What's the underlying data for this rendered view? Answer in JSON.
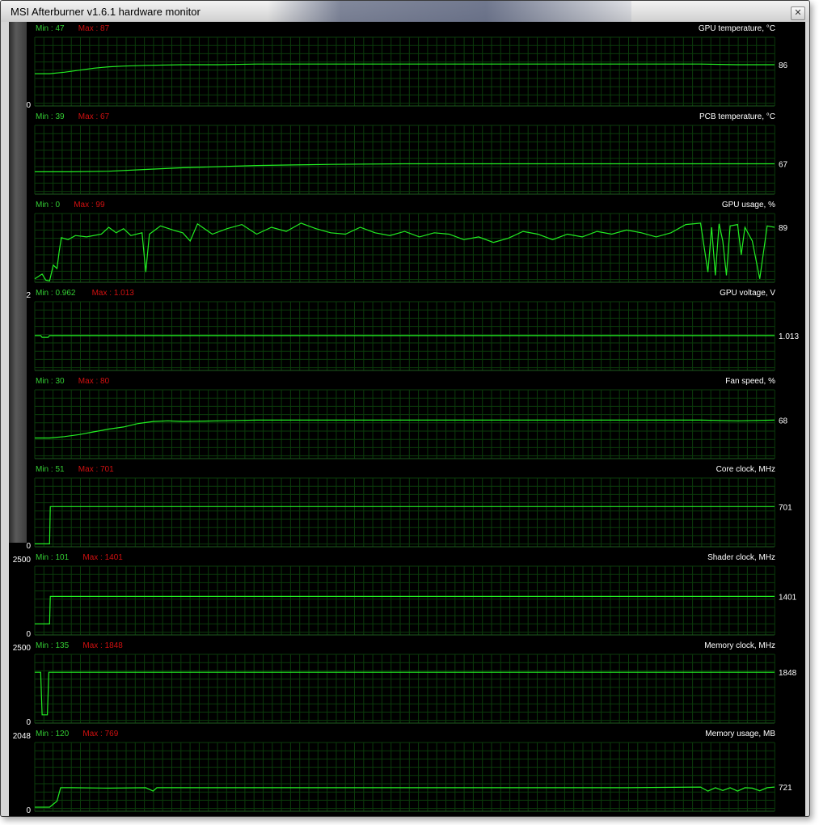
{
  "window": {
    "title": "MSI Afterburner v1.6.1 hardware monitor",
    "close_glyph": "✕"
  },
  "colors": {
    "background": "#000000",
    "grid": "#0b3b0b",
    "line": "#22ee22",
    "min_text": "#33cc33",
    "max_text": "#d01010",
    "label_text": "#ffffff"
  },
  "graphs": [
    {
      "label": "GPU temperature, °C",
      "min": "Min : 47",
      "max": "Max : 87",
      "current": "86",
      "axis_top": "",
      "axis_bottom": "0",
      "range": [
        0,
        100
      ],
      "points": [
        [
          0,
          47
        ],
        [
          0.02,
          47
        ],
        [
          0.04,
          49
        ],
        [
          0.06,
          52
        ],
        [
          0.08,
          55
        ],
        [
          0.1,
          57
        ],
        [
          0.12,
          58
        ],
        [
          0.15,
          59
        ],
        [
          0.2,
          60
        ],
        [
          0.25,
          60
        ],
        [
          0.3,
          61
        ],
        [
          0.4,
          61
        ],
        [
          0.5,
          61
        ],
        [
          0.6,
          61
        ],
        [
          0.7,
          61
        ],
        [
          0.8,
          61
        ],
        [
          0.9,
          61
        ],
        [
          0.95,
          60
        ],
        [
          1,
          60
        ]
      ]
    },
    {
      "label": "PCB temperature, °C",
      "min": "Min : 39",
      "max": "Max : 67",
      "current": "67",
      "axis_top": "",
      "axis_bottom": "",
      "range": [
        0,
        120
      ],
      "points": [
        [
          0,
          39
        ],
        [
          0.05,
          39
        ],
        [
          0.1,
          40
        ],
        [
          0.15,
          43
        ],
        [
          0.2,
          46
        ],
        [
          0.25,
          48
        ],
        [
          0.3,
          50
        ],
        [
          0.35,
          51
        ],
        [
          0.4,
          52
        ],
        [
          0.5,
          53
        ],
        [
          0.6,
          53
        ],
        [
          0.7,
          53
        ],
        [
          0.8,
          53
        ],
        [
          0.9,
          53
        ],
        [
          1,
          53
        ]
      ]
    },
    {
      "label": "GPU usage, %",
      "min": "Min : 0",
      "max": "Max : 99",
      "current": "89",
      "axis_top": "",
      "axis_bottom": "",
      "range": [
        0,
        100
      ],
      "points": [
        [
          0,
          5
        ],
        [
          0.01,
          12
        ],
        [
          0.015,
          3
        ],
        [
          0.02,
          2
        ],
        [
          0.025,
          25
        ],
        [
          0.03,
          20
        ],
        [
          0.033,
          45
        ],
        [
          0.036,
          65
        ],
        [
          0.045,
          62
        ],
        [
          0.055,
          68
        ],
        [
          0.07,
          66
        ],
        [
          0.09,
          70
        ],
        [
          0.1,
          80
        ],
        [
          0.11,
          72
        ],
        [
          0.12,
          78
        ],
        [
          0.13,
          68
        ],
        [
          0.145,
          72
        ],
        [
          0.15,
          15
        ],
        [
          0.155,
          70
        ],
        [
          0.17,
          82
        ],
        [
          0.19,
          75
        ],
        [
          0.2,
          72
        ],
        [
          0.21,
          60
        ],
        [
          0.22,
          85
        ],
        [
          0.24,
          70
        ],
        [
          0.26,
          78
        ],
        [
          0.28,
          84
        ],
        [
          0.3,
          70
        ],
        [
          0.32,
          80
        ],
        [
          0.34,
          74
        ],
        [
          0.36,
          86
        ],
        [
          0.38,
          78
        ],
        [
          0.4,
          72
        ],
        [
          0.42,
          70
        ],
        [
          0.44,
          80
        ],
        [
          0.46,
          72
        ],
        [
          0.48,
          68
        ],
        [
          0.5,
          74
        ],
        [
          0.52,
          66
        ],
        [
          0.54,
          72
        ],
        [
          0.56,
          70
        ],
        [
          0.58,
          62
        ],
        [
          0.6,
          66
        ],
        [
          0.62,
          58
        ],
        [
          0.64,
          64
        ],
        [
          0.66,
          74
        ],
        [
          0.68,
          70
        ],
        [
          0.7,
          62
        ],
        [
          0.72,
          70
        ],
        [
          0.74,
          66
        ],
        [
          0.76,
          74
        ],
        [
          0.78,
          70
        ],
        [
          0.8,
          76
        ],
        [
          0.82,
          72
        ],
        [
          0.84,
          66
        ],
        [
          0.86,
          72
        ],
        [
          0.88,
          84
        ],
        [
          0.9,
          86
        ],
        [
          0.91,
          15
        ],
        [
          0.915,
          80
        ],
        [
          0.92,
          10
        ],
        [
          0.925,
          85
        ],
        [
          0.93,
          60
        ],
        [
          0.935,
          10
        ],
        [
          0.94,
          82
        ],
        [
          0.95,
          84
        ],
        [
          0.955,
          40
        ],
        [
          0.96,
          80
        ],
        [
          0.97,
          60
        ],
        [
          0.98,
          5
        ],
        [
          0.99,
          82
        ],
        [
          1,
          80
        ]
      ]
    },
    {
      "label": "GPU voltage, V",
      "min": "Min : 0.962",
      "max": "Max : 1.013",
      "current": "1.013",
      "axis_top": "2",
      "axis_bottom": "",
      "range": [
        0,
        2
      ],
      "points": [
        [
          0,
          1.013
        ],
        [
          0.008,
          1.013
        ],
        [
          0.01,
          0.962
        ],
        [
          0.018,
          0.962
        ],
        [
          0.02,
          1.013
        ],
        [
          1,
          1.013
        ]
      ]
    },
    {
      "label": "Fan speed, %",
      "min": "Min : 30",
      "max": "Max : 80",
      "current": "68",
      "axis_top": "",
      "axis_bottom": "",
      "range": [
        0,
        100
      ],
      "points": [
        [
          0,
          30
        ],
        [
          0.02,
          30
        ],
        [
          0.04,
          32
        ],
        [
          0.06,
          35
        ],
        [
          0.08,
          39
        ],
        [
          0.1,
          43
        ],
        [
          0.12,
          46
        ],
        [
          0.14,
          51
        ],
        [
          0.16,
          54
        ],
        [
          0.18,
          55
        ],
        [
          0.2,
          54
        ],
        [
          0.25,
          55
        ],
        [
          0.3,
          56
        ],
        [
          0.4,
          56
        ],
        [
          0.5,
          56
        ],
        [
          0.6,
          56
        ],
        [
          0.7,
          56
        ],
        [
          0.8,
          56
        ],
        [
          0.9,
          56
        ],
        [
          0.95,
          55
        ],
        [
          1,
          56
        ]
      ]
    },
    {
      "label": "Core clock, MHz",
      "min": "Min : 51",
      "max": "Max : 701",
      "current": "701",
      "axis_top": "",
      "axis_bottom": "0",
      "range": [
        0,
        1200
      ],
      "points": [
        [
          0,
          51
        ],
        [
          0.02,
          51
        ],
        [
          0.021,
          701
        ],
        [
          1,
          701
        ]
      ]
    },
    {
      "label": "Shader clock, MHz",
      "min": "Min : 101",
      "max": "Max : 1401",
      "current": "1401",
      "axis_top": "2500",
      "axis_bottom": "0",
      "range": [
        0,
        2500
      ],
      "points": [
        [
          0,
          400
        ],
        [
          0.02,
          400
        ],
        [
          0.021,
          1401
        ],
        [
          1,
          1401
        ]
      ]
    },
    {
      "label": "Memory clock, MHz",
      "min": "Min : 135",
      "max": "Max : 1848",
      "current": "1848",
      "axis_top": "2500",
      "axis_bottom": "0",
      "range": [
        0,
        2500
      ],
      "points": [
        [
          0,
          1848
        ],
        [
          0.008,
          1848
        ],
        [
          0.01,
          300
        ],
        [
          0.017,
          300
        ],
        [
          0.019,
          1848
        ],
        [
          1,
          1848
        ]
      ]
    },
    {
      "label": "Memory usage, MB",
      "min": "Min : 120",
      "max": "Max : 769",
      "current": "721",
      "axis_top": "2048",
      "axis_bottom": "0",
      "range": [
        0,
        2048
      ],
      "points": [
        [
          0,
          120
        ],
        [
          0.02,
          120
        ],
        [
          0.03,
          300
        ],
        [
          0.035,
          700
        ],
        [
          0.05,
          700
        ],
        [
          0.1,
          690
        ],
        [
          0.15,
          700
        ],
        [
          0.16,
          600
        ],
        [
          0.165,
          700
        ],
        [
          0.2,
          700
        ],
        [
          0.3,
          700
        ],
        [
          0.4,
          700
        ],
        [
          0.5,
          700
        ],
        [
          0.6,
          700
        ],
        [
          0.7,
          700
        ],
        [
          0.8,
          700
        ],
        [
          0.9,
          720
        ],
        [
          0.91,
          600
        ],
        [
          0.92,
          700
        ],
        [
          0.93,
          620
        ],
        [
          0.94,
          700
        ],
        [
          0.95,
          600
        ],
        [
          0.96,
          700
        ],
        [
          0.97,
          690
        ],
        [
          0.98,
          610
        ],
        [
          0.99,
          700
        ],
        [
          1,
          721
        ]
      ]
    }
  ]
}
